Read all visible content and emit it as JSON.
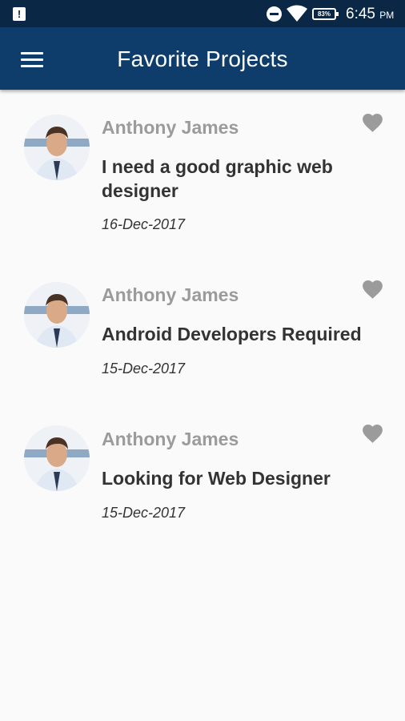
{
  "status_bar": {
    "battery": "83%",
    "time": "6:45",
    "ampm": "PM"
  },
  "app_bar": {
    "title": "Favorite Projects"
  },
  "projects": [
    {
      "name": "Anthony James",
      "title": "I need a good graphic web designer",
      "date": "16-Dec-2017"
    },
    {
      "name": "Anthony James",
      "title": "Android Developers Required",
      "date": "15-Dec-2017"
    },
    {
      "name": "Anthony James",
      "title": "Looking for Web Designer",
      "date": "15-Dec-2017"
    }
  ],
  "colors": {
    "status_bar": "#0b2746",
    "app_bar": "#0e3d6b",
    "heart": "#9b9b9b",
    "name": "#9b9b9b",
    "title": "#333333"
  },
  "icons": [
    "notification-icon",
    "dnd-icon",
    "wifi-icon",
    "battery-icon",
    "menu-icon",
    "heart-icon"
  ]
}
